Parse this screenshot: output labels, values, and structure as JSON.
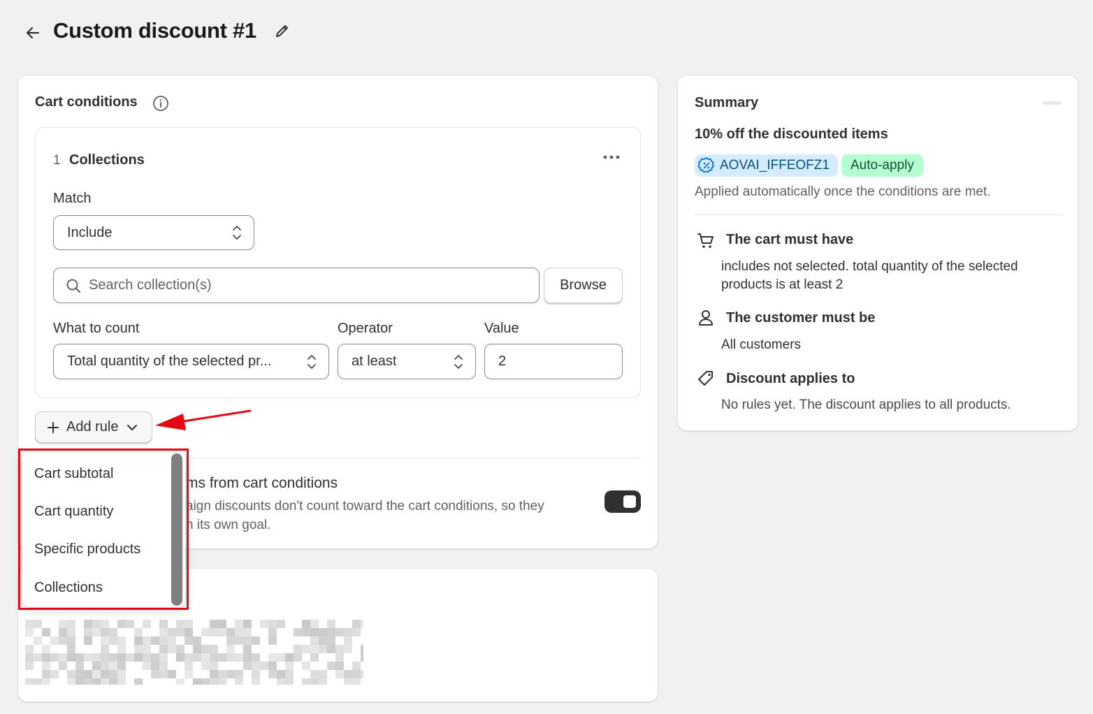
{
  "header": {
    "title": "Custom discount #1"
  },
  "cart_conditions": {
    "title": "Cart conditions",
    "rule": {
      "number": "1",
      "name": "Collections",
      "match_label": "Match",
      "match_value": "Include",
      "search_placeholder": "Search collection(s)",
      "browse_label": "Browse",
      "what_to_count_label": "What to count",
      "what_to_count_value": "Total quantity of the selected pr...",
      "operator_label": "Operator",
      "operator_value": "at least",
      "value_label": "Value",
      "value_value": "2"
    },
    "add_rule_label": "Add rule",
    "exclude_title": "ms from cart conditions",
    "exclude_desc_line1": "aign discounts don't count toward the cart conditions, so they",
    "exclude_desc_line2": "n its own goal.",
    "toggle_on": true
  },
  "dropdown": {
    "items": [
      "Cart subtotal",
      "Cart quantity",
      "Specific products",
      "Collections"
    ]
  },
  "summary": {
    "title": "Summary",
    "heading": "10% off the discounted items",
    "code": "AOVAI_IFFEOFZ1",
    "auto_badge": "Auto-apply",
    "applied_text": "Applied automatically once the conditions are met.",
    "cart_title": "The cart must have",
    "cart_text_line1": "includes not selected. total quantity of the selected",
    "cart_text_line2": "products is at least 2",
    "customer_title": "The customer must be",
    "customer_text": "All customers",
    "applies_title": "Discount applies to",
    "applies_text": "No rules yet. The discount applies to all products."
  },
  "colors": {
    "page_bg": "#f1f1f1",
    "code_badge_bg": "#d5ebff",
    "auto_badge_bg": "#b4fed2",
    "annotation_red": "#e50914",
    "toggle_on": "#303030"
  },
  "icons": {
    "back": "arrow-left-icon",
    "edit": "pencil-icon",
    "info": "info-icon",
    "more": "horizontal-dots-icon",
    "search": "search-icon",
    "add": "plus-icon",
    "chevron": "chevron-down-icon",
    "select": "chevron-up-down-icon",
    "code": "discount-badge-icon",
    "cart": "cart-icon",
    "customer": "person-icon",
    "applies": "tag-icon"
  }
}
